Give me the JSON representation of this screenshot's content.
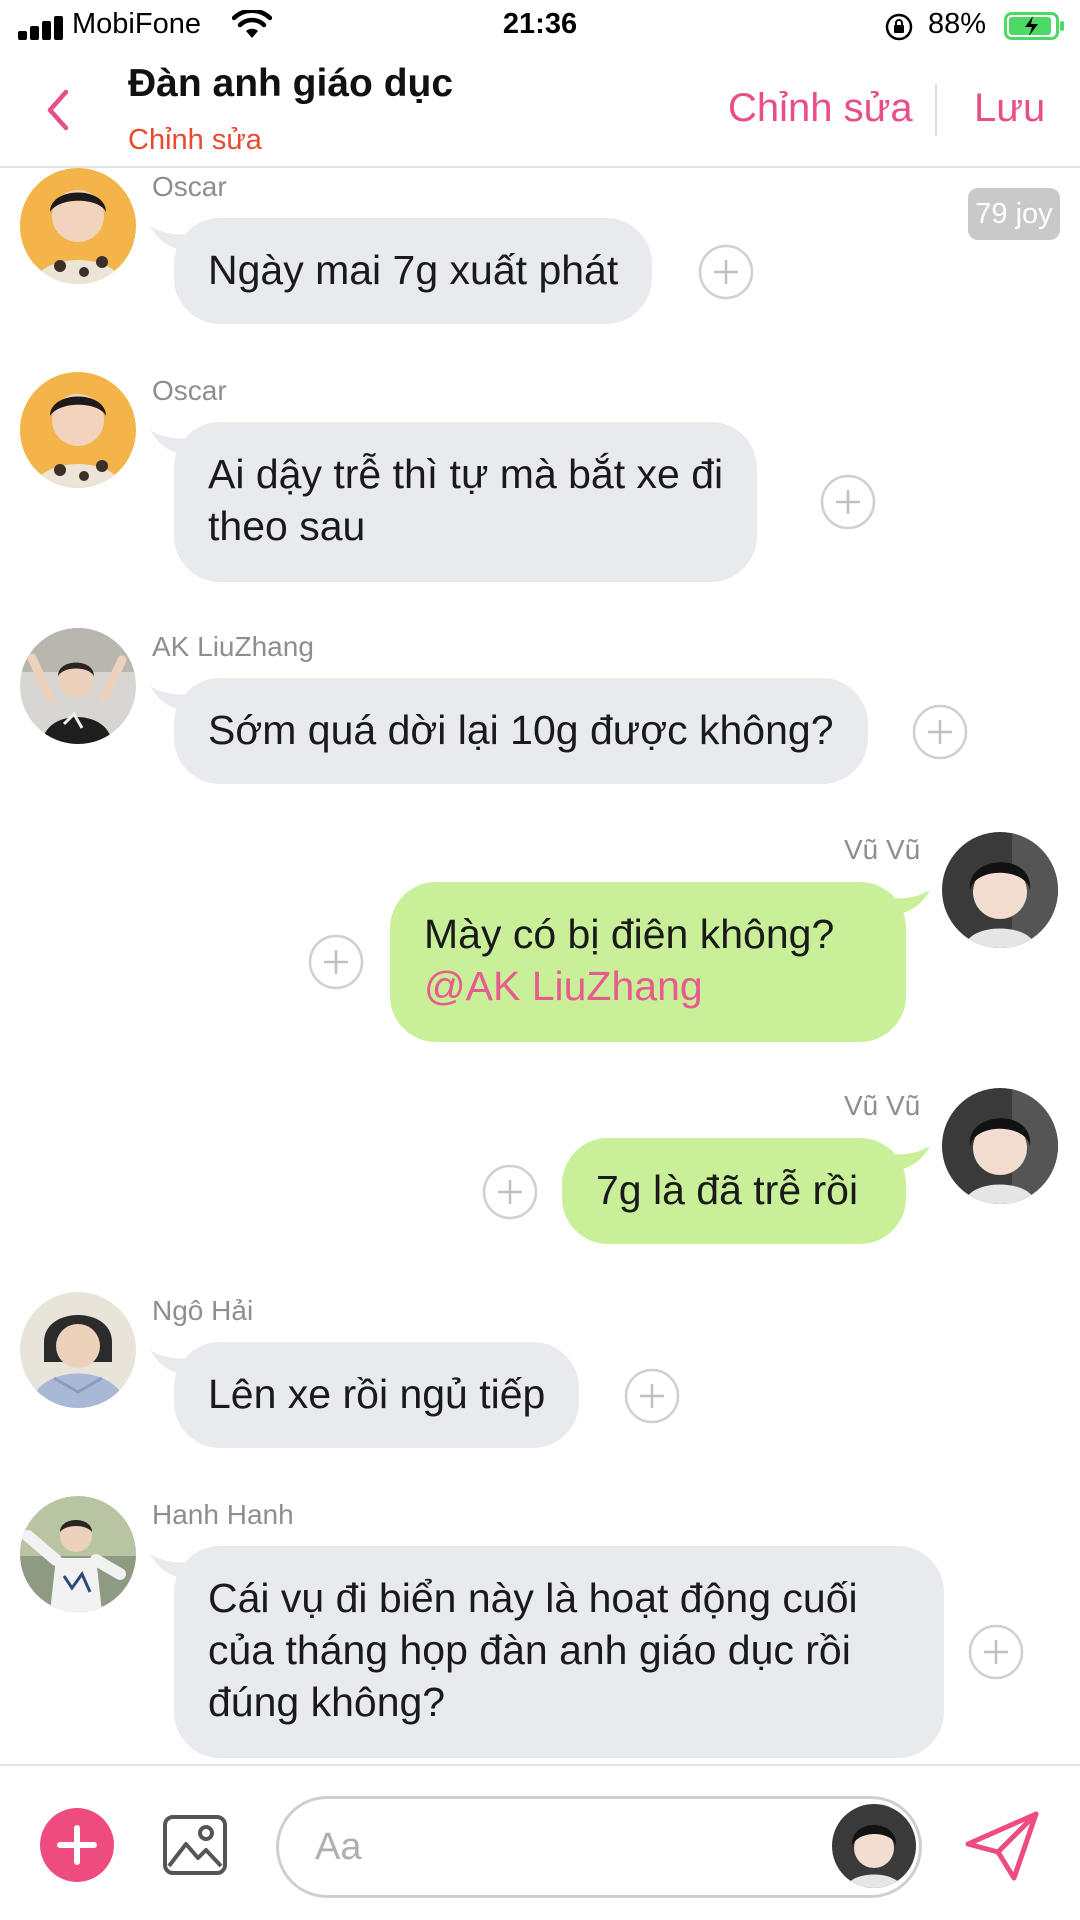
{
  "status_bar": {
    "carrier": "MobiFone",
    "time": "21:36",
    "battery": "88%"
  },
  "header": {
    "title": "Đàn anh giáo dục",
    "subtitle": "Chỉnh sửa",
    "edit_label": "Chỉnh sửa",
    "save_label": "Lưu"
  },
  "timestamp_badge": "79 joy",
  "messages": [
    {
      "sender": "Oscar",
      "direction": "in",
      "text": "Ngày mai 7g xuất phát"
    },
    {
      "sender": "Oscar",
      "direction": "in",
      "lines": [
        "Ai dậy trễ thì tự mà bắt xe đi",
        "theo sau"
      ]
    },
    {
      "sender": "AK LiuZhang",
      "direction": "in",
      "text": "Sớm quá dời lại 10g được không?"
    },
    {
      "sender": "Vũ Vũ",
      "direction": "out",
      "text": "Mày có bị điên không?",
      "mention": "@AK LiuZhang"
    },
    {
      "sender": "Vũ Vũ",
      "direction": "out",
      "text": "7g là đã trễ rồi"
    },
    {
      "sender": "Ngô Hải",
      "direction": "in",
      "text": "Lên xe rồi ngủ tiếp"
    },
    {
      "sender": "Hanh Hanh",
      "direction": "in",
      "lines": [
        "Cái vụ đi biển này là hoạt động cuối",
        "của tháng họp đàn anh giáo dục rồi",
        "đúng không?"
      ]
    }
  ],
  "composer": {
    "placeholder": "Aa"
  },
  "colors": {
    "accent_pink": "#e84f86",
    "subtitle_red": "#e8492f",
    "incoming_bubble": "#e9eaee",
    "outgoing_bubble": "#c9ef98",
    "battery_green": "#4cd964"
  },
  "icons": [
    "back-icon",
    "reaction-add-icon",
    "plus-icon",
    "image-icon",
    "send-icon",
    "wifi-icon",
    "signal-icon",
    "battery-icon",
    "rotation-lock-icon"
  ]
}
